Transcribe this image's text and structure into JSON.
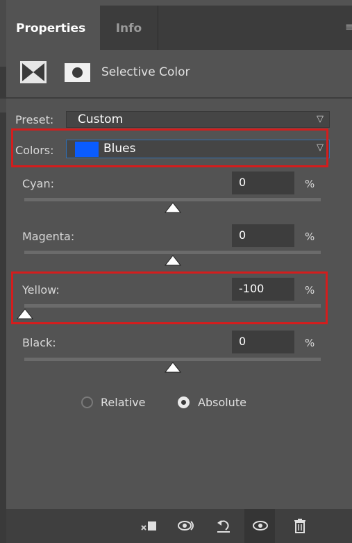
{
  "tabs": [
    {
      "label": "Properties",
      "active": true
    },
    {
      "label": "Info",
      "active": false
    }
  ],
  "header": {
    "title": "Selective Color",
    "icons": [
      "adjustment-layer-icon",
      "layer-mask-icon"
    ]
  },
  "preset": {
    "label": "Preset:",
    "value": "Custom"
  },
  "colors": {
    "label": "Colors:",
    "value": "Blues",
    "swatch": "#0a5cff"
  },
  "sliders": [
    {
      "key": "cyan",
      "label": "Cyan:",
      "value": "0",
      "unit": "%",
      "position": 0.5
    },
    {
      "key": "magenta",
      "label": "Magenta:",
      "value": "0",
      "unit": "%",
      "position": 0.5
    },
    {
      "key": "yellow",
      "label": "Yellow:",
      "value": "-100",
      "unit": "%",
      "position": 0.0
    },
    {
      "key": "black",
      "label": "Black:",
      "value": "0",
      "unit": "%",
      "position": 0.5
    }
  ],
  "method": {
    "options": [
      "Relative",
      "Absolute"
    ],
    "selected": "Absolute"
  },
  "bottom_toolbar": [
    "clip-to-layer-icon",
    "view-previous-state-icon",
    "reset-icon",
    "visibility-icon",
    "trash-icon"
  ],
  "colors_theme": {
    "highlight": "#d41d1d",
    "panel": "#535353"
  }
}
